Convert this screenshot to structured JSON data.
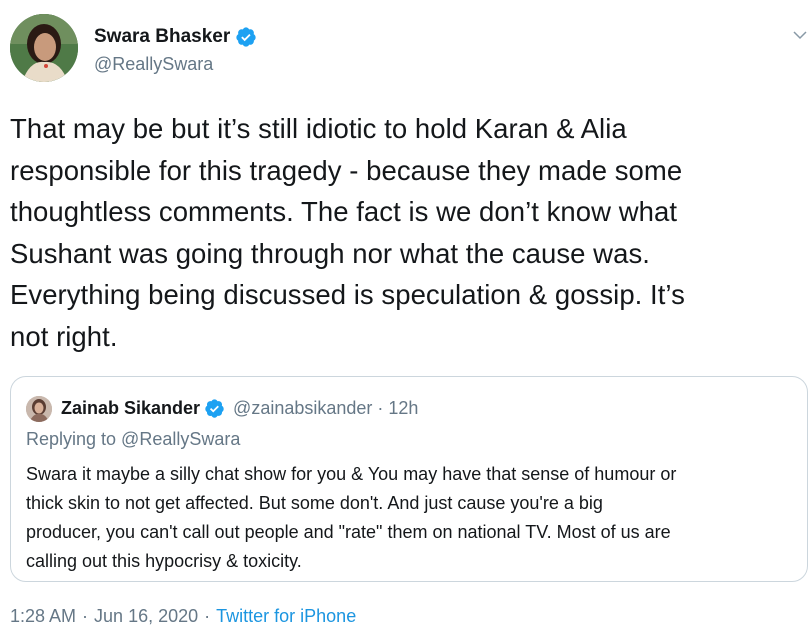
{
  "tweet": {
    "author": {
      "display_name": "Swara Bhasker",
      "handle": "@ReallySwara",
      "verified": true,
      "avatar_icon": "profile-photo"
    },
    "text": "That may be but it’s still idiotic to hold Karan & Alia\nresponsible for this tragedy - because they made some\nthoughtless comments. The fact is we don’t know what\nSushant was going through nor what the cause was.\nEverything being discussed is speculation & gossip. It’s\nnot right.",
    "quoted_tweet": {
      "author": {
        "display_name": "Zainab Sikander",
        "handle": "@zainabsikander",
        "verified": true
      },
      "separator": "·",
      "time": "12h",
      "replying_to": "Replying to @ReallySwara",
      "text": "Swara it maybe a silly chat show for you & You may have that sense of humour or\nthick skin to not get affected. But some don't. And just cause you're a big\nproducer, you can't call out people and \"rate\" them on national TV. Most of us are\ncalling out this hypocrisy & toxicity."
    },
    "meta": {
      "time": "1:28 AM",
      "separator": "·",
      "date": "Jun 16, 2020",
      "source": "Twitter for iPhone"
    },
    "menu_icon": "chevron-down"
  },
  "colors": {
    "verified_blue": "#1da1f2",
    "link_blue": "#1b95e0",
    "secondary_text": "#657786",
    "border": "#ccd6dd"
  }
}
